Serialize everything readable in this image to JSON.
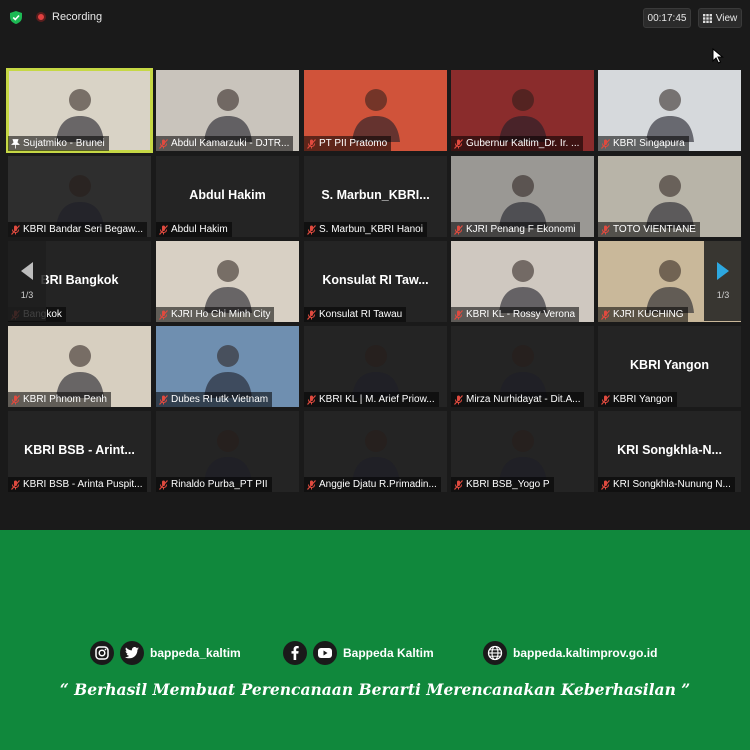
{
  "window": {
    "recording_label": "Recording",
    "timer": "00:17:45",
    "view_label": "View"
  },
  "pagination": {
    "left": "1/3",
    "right": "1/3"
  },
  "tiles": [
    {
      "label": "Sujatmiko - Brunei",
      "name": "",
      "active": true,
      "pinned": true,
      "bg": "#d9d3c6"
    },
    {
      "label": "Abdul Kamarzuki - DJTR...",
      "name": "",
      "bg": "#c9c4bc"
    },
    {
      "label": "PT PII Pratomo",
      "name": "",
      "bg": "#d0533a"
    },
    {
      "label": "Gubernur Kaltim_Dr. Ir. ...",
      "name": "",
      "bg": "#8a2c2c"
    },
    {
      "label": "KBRI Singapura",
      "name": "",
      "bg": "#d6d9dc"
    },
    {
      "label": "KBRI Bandar Seri Begaw...",
      "name": "",
      "bg": "#2e2e2e"
    },
    {
      "label": "Abdul Hakim",
      "name": "Abdul Hakim",
      "bg": "#242424"
    },
    {
      "label": "S. Marbun_KBRI Hanoi",
      "name": "S. Marbun_KBRI...",
      "bg": "#242424"
    },
    {
      "label": "KJRI Penang F Ekonomi",
      "name": "",
      "bg": "#9a9894"
    },
    {
      "label": "TOTO VIENTIANE",
      "name": "",
      "bg": "#b8b4a8"
    },
    {
      "label": "Bangkok",
      "name": "BRI Bangkok",
      "bg": "#242424"
    },
    {
      "label": "KJRI Ho Chi Minh City",
      "name": "",
      "bg": "#d8d0c4"
    },
    {
      "label": "Konsulat RI Tawau",
      "name": "Konsulat RI Taw...",
      "bg": "#242424"
    },
    {
      "label": "KBRI KL - Rossy Verona",
      "name": "",
      "bg": "#cfc8c0"
    },
    {
      "label": "KJRI KUCHING",
      "name": "",
      "bg": "#c9b89a"
    },
    {
      "label": "KBRI Phnom Penh",
      "name": "",
      "bg": "#d7cfc0"
    },
    {
      "label": "Dubes RI utk Vietnam",
      "name": "",
      "bg": "#6f8fb0"
    },
    {
      "label": "KBRI KL | M. Arief Priow...",
      "name": "",
      "bg": "#242424"
    },
    {
      "label": "Mirza Nurhidayat - Dit.A...",
      "name": "",
      "bg": "#242424"
    },
    {
      "label": "KBRI Yangon",
      "name": "KBRI Yangon",
      "bg": "#242424"
    },
    {
      "label": "KBRI BSB - Arinta Puspit...",
      "name": "KBRI BSB - Arint...",
      "bg": "#242424"
    },
    {
      "label": "Rinaldo Purba_PT PII",
      "name": "",
      "bg": "#242424"
    },
    {
      "label": "Anggie Djatu R.Primadin...",
      "name": "",
      "bg": "#242424"
    },
    {
      "label": "KBRI BSB_Yogo P",
      "name": "",
      "bg": "#242424"
    },
    {
      "label": "KRI Songkhla-Nunung N...",
      "name": "KRI Songkhla-N...",
      "bg": "#242424"
    }
  ],
  "footer": {
    "instagram_twitter_handle": "bappeda_kaltim",
    "facebook_youtube_handle": "Bappeda Kaltim",
    "website": "bappeda.kaltimprov.go.id",
    "tagline": "“ Berhasil  Membuat Perencanaan Berarti Merencanakan Keberhasilan ”",
    "bg_color": "#10883c"
  },
  "colors": {
    "active_border": "#c6d845",
    "recording": "#e0403f",
    "nav_arrow": "#2da8e0"
  },
  "icons": [
    "shield-icon",
    "recording-dot-icon",
    "grid-view-icon",
    "cursor-icon",
    "mic-muted-icon",
    "pin-icon",
    "prev-page-icon",
    "next-page-icon",
    "instagram-icon",
    "twitter-icon",
    "facebook-icon",
    "youtube-icon",
    "globe-icon"
  ]
}
